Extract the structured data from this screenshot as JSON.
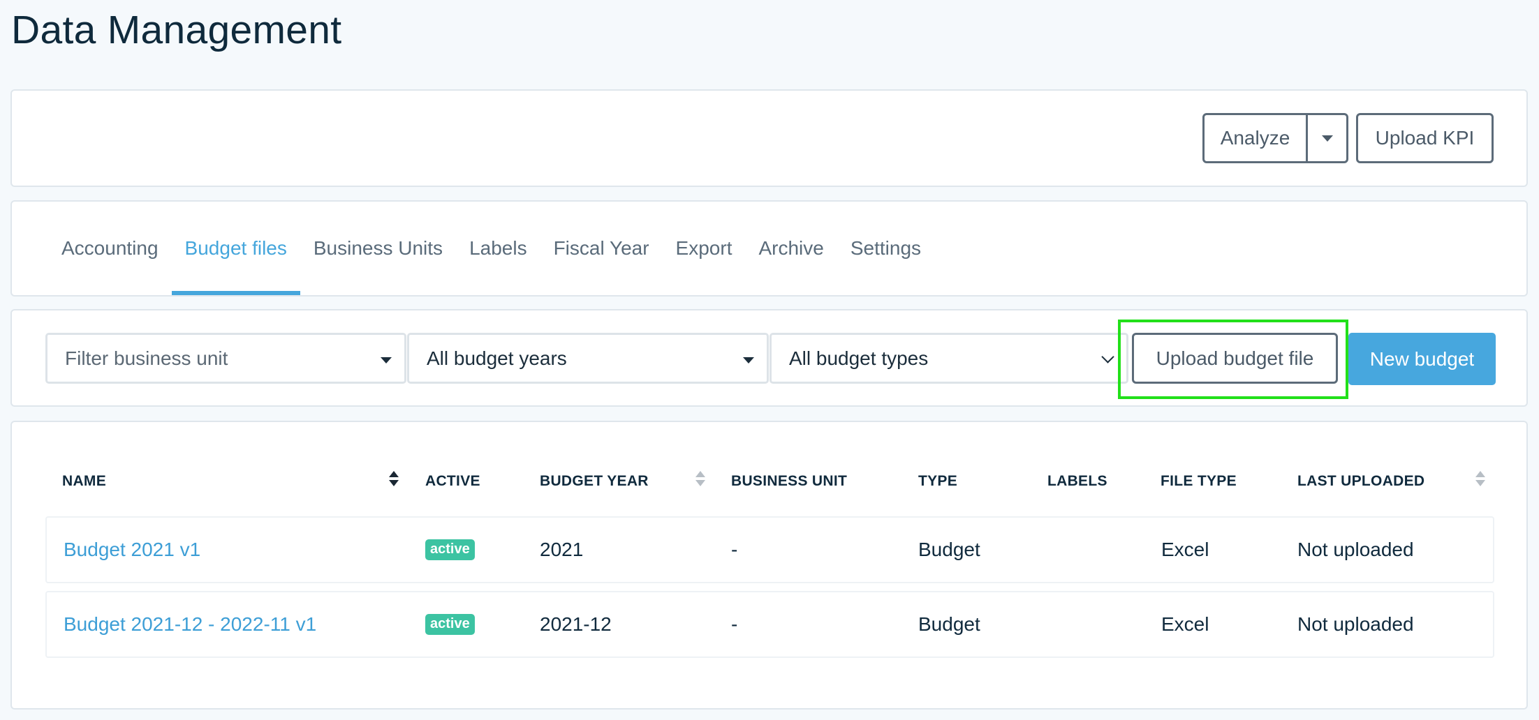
{
  "page": {
    "title": "Data Management"
  },
  "actions": {
    "analyze_label": "Analyze",
    "upload_kpi_label": "Upload KPI"
  },
  "tabs": [
    {
      "label": "Accounting",
      "active": false
    },
    {
      "label": "Budget files",
      "active": true
    },
    {
      "label": "Business Units",
      "active": false
    },
    {
      "label": "Labels",
      "active": false
    },
    {
      "label": "Fiscal Year",
      "active": false
    },
    {
      "label": "Export",
      "active": false
    },
    {
      "label": "Archive",
      "active": false
    },
    {
      "label": "Settings",
      "active": false
    }
  ],
  "filters": {
    "business_unit": "Filter business unit",
    "budget_year": "All budget years",
    "budget_type": "All budget types",
    "upload_budget_label": "Upload budget file",
    "new_budget_label": "New budget"
  },
  "table": {
    "columns": [
      "NAME",
      "ACTIVE",
      "BUDGET YEAR",
      "BUSINESS UNIT",
      "TYPE",
      "LABELS",
      "FILE TYPE",
      "LAST UPLOADED"
    ],
    "rows": [
      {
        "name": "Budget 2021 v1",
        "active": "active",
        "budget_year": "2021",
        "business_unit": "-",
        "type": "Budget",
        "labels": "",
        "file_type": "Excel",
        "last_uploaded": "Not uploaded"
      },
      {
        "name": "Budget 2021-12 - 2022-11 v1",
        "active": "active",
        "budget_year": "2021-12",
        "business_unit": "-",
        "type": "Budget",
        "labels": "",
        "file_type": "Excel",
        "last_uploaded": "Not uploaded"
      }
    ]
  },
  "colors": {
    "accent": "#45a6dc",
    "badge": "#3cc3a2",
    "highlight": "#22e01a"
  }
}
